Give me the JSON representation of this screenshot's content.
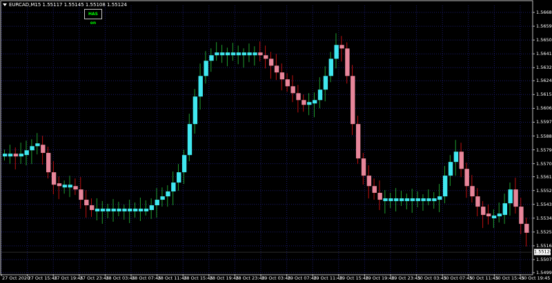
{
  "header": {
    "symbol_info": "EURCAD,M15  1.55117 1.55145 1.55108 1.55124",
    "badge": "HAS on"
  },
  "colors": {
    "background": "#000000",
    "grid": "#1c1c6e",
    "bull_body": "#40e8f0",
    "bear_body": "#e8869a",
    "bull_wick": "#1fa030",
    "bear_wick": "#c01010",
    "axis": "#c0c0c0"
  },
  "chart_data": {
    "type": "candlestick",
    "indicator": "Heikin Ashi Smoothed",
    "symbol": "EURCAD",
    "timeframe": "M15",
    "ylim": [
      1.5499,
      1.56685
    ],
    "y_ticks": [
      "1.56685",
      "1.56595",
      "1.56505",
      "1.56415",
      "1.56325",
      "1.56240",
      "1.56150",
      "1.56060",
      "1.55970",
      "1.55880",
      "1.55790",
      "1.55700",
      "1.55615",
      "1.55525",
      "1.55435",
      "1.55345",
      "1.55255",
      "1.55165",
      "1.55075",
      "1.54990"
    ],
    "current_price": "1.55124",
    "x_ticks": [
      "27 Oct 2020",
      "27 Oct 15:45",
      "27 Oct 19:45",
      "27 Oct 23:45",
      "28 Oct 03:45",
      "28 Oct 07:45",
      "28 Oct 11:45",
      "28 Oct 15:45",
      "28 Oct 19:45",
      "28 Oct 23:45",
      "29 Oct 03:45",
      "29 Oct 07:45",
      "29 Oct 11:45",
      "29 Oct 15:45",
      "29 Oct 19:45",
      "29 Oct 23:45",
      "30 Oct 03:45",
      "30 Oct 07:45",
      "30 Oct 11:45",
      "30 Oct 15:45",
      "30 Oct 19:45"
    ],
    "ha_close": [
      1.55756,
      1.55756,
      1.55743,
      1.55756,
      1.55787,
      1.55814,
      1.55823,
      1.5577,
      1.55644,
      1.55563,
      1.55554,
      1.55554,
      1.55554,
      1.55532,
      1.55465,
      1.55429,
      1.55398,
      1.55398,
      1.55398,
      1.55398,
      1.55398,
      1.55398,
      1.55398,
      1.55398,
      1.55398,
      1.55398,
      1.55398,
      1.55429,
      1.55465,
      1.55487,
      1.55519,
      1.55577,
      1.55644,
      1.55756,
      1.55958,
      1.56137,
      1.56271,
      1.5637,
      1.56406,
      1.56415,
      1.56415,
      1.56415,
      1.56415,
      1.56415,
      1.56415,
      1.56415,
      1.56415,
      1.56406,
      1.56383,
      1.56338,
      1.56294,
      1.56249,
      1.56204,
      1.56159,
      1.56114,
      1.56083,
      1.56092,
      1.56114,
      1.56182,
      1.56271,
      1.56383,
      1.56473,
      1.5645,
      1.56271,
      1.55958,
      1.55734,
      1.55622,
      1.55554,
      1.5551,
      1.55465,
      1.55465,
      1.55465,
      1.55465,
      1.55465,
      1.55465,
      1.55465,
      1.55465,
      1.55465,
      1.55465,
      1.55465,
      1.55487,
      1.55622,
      1.55711,
      1.55778,
      1.55666,
      1.55554,
      1.55487,
      1.5542,
      1.55366,
      1.55353,
      1.55353,
      1.55366,
      1.55442,
      1.55532,
      1.5542,
      1.55308,
      1.5525
    ]
  }
}
